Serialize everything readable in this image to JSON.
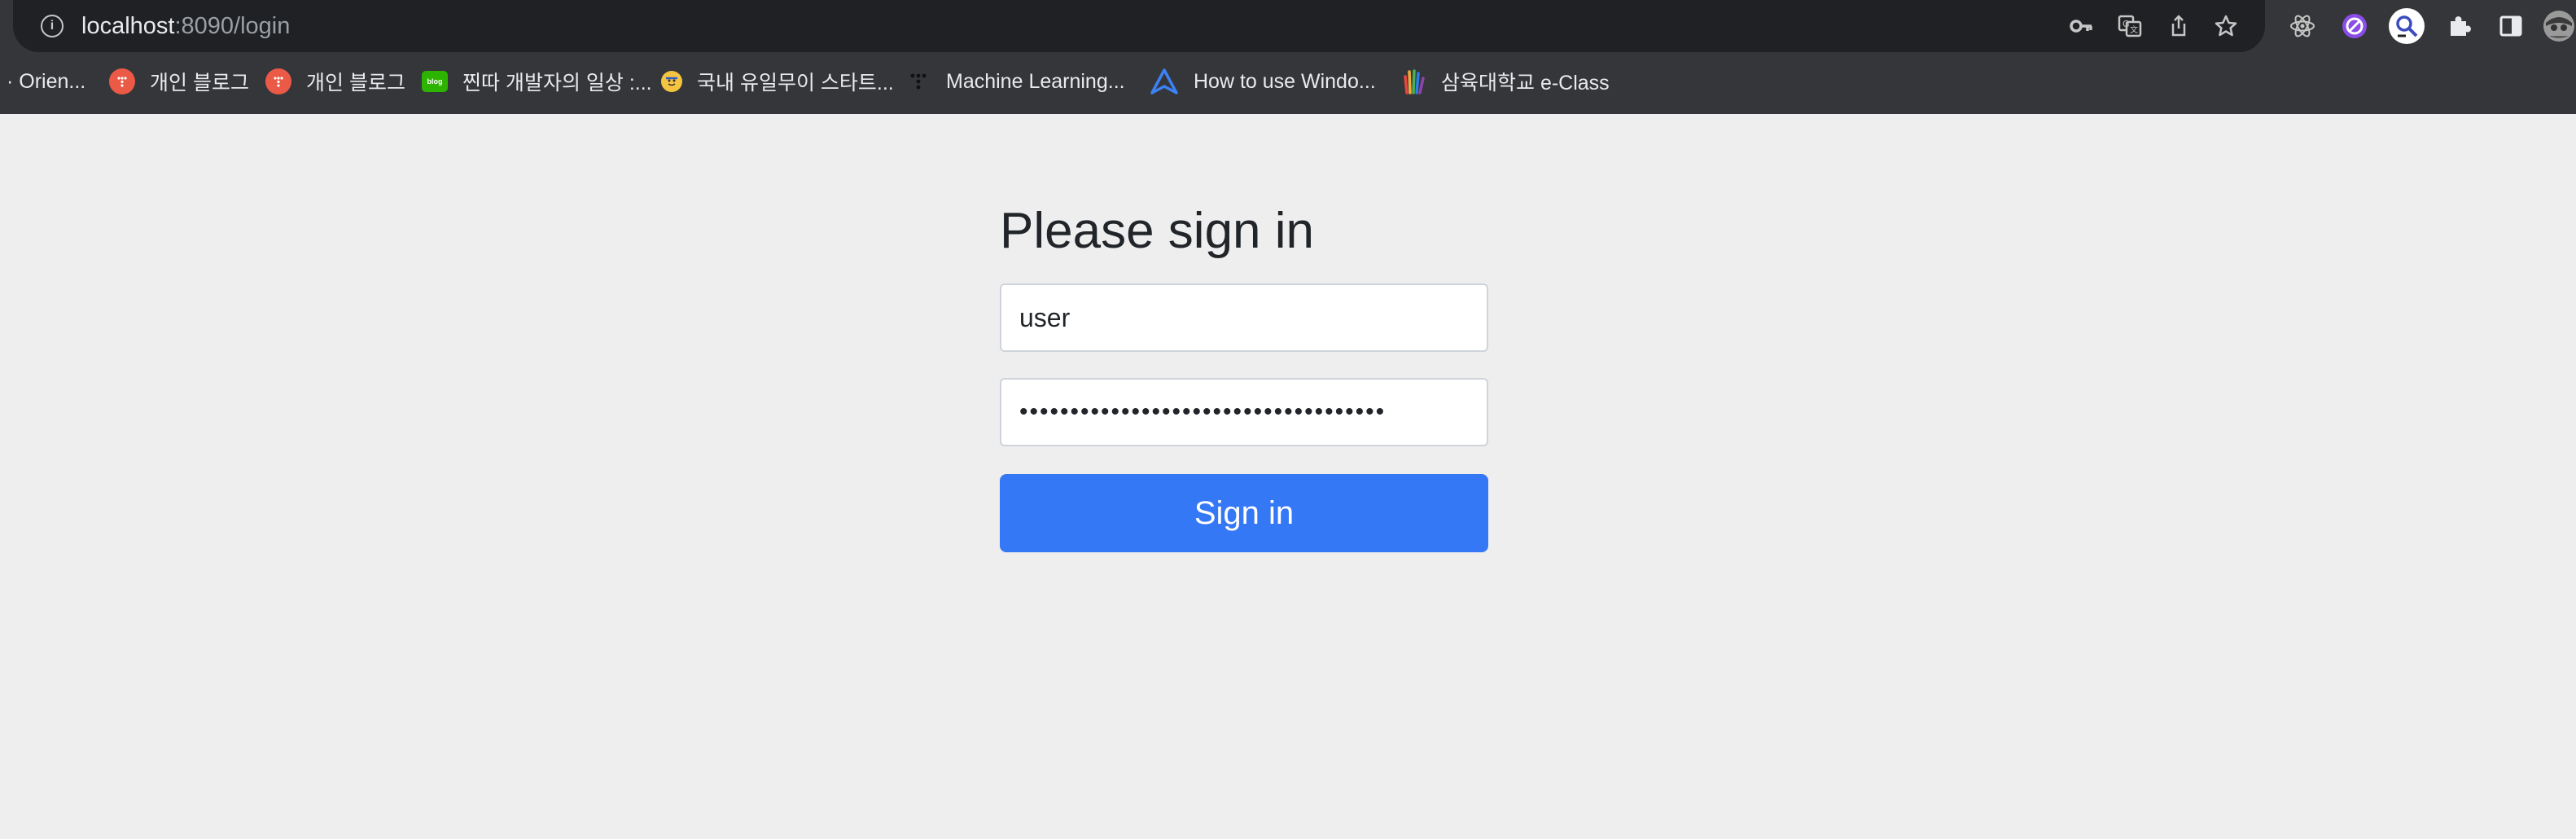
{
  "browser": {
    "url_host": "localhost",
    "url_path": ":8090/login",
    "toolbar_icons": [
      "info-icon",
      "key-icon",
      "translate-icon",
      "share-icon",
      "bookmark-star-icon",
      "react-devtools-icon",
      "ad-block-icon",
      "search-extension-icon",
      "extensions-puzzle-icon",
      "side-panel-icon",
      "profile-avatar-icon"
    ],
    "bookmarks": [
      {
        "label": "· Orien...",
        "icon": "none"
      },
      {
        "label": "개인 블로그",
        "icon": "blog-tistory-icon"
      },
      {
        "label": "개인 블로그",
        "icon": "blog-tistory-icon"
      },
      {
        "label": "찐따 개발자의 일상 :...",
        "icon": "naver-blog-icon"
      },
      {
        "label": "국내 유일무이 스타트...",
        "icon": "emoji-face-icon"
      },
      {
        "label": "Machine Learning...",
        "icon": "dots-grid-icon"
      },
      {
        "label": "How to use Windo...",
        "icon": "triangle-logo-icon"
      },
      {
        "label": "삼육대학교 e-Class",
        "icon": "hand-logo-icon"
      }
    ]
  },
  "login": {
    "title": "Please sign in",
    "username_value": "user",
    "password_value": "••••••••••••••••••••••••••••••••••••",
    "submit_label": "Sign in"
  },
  "colors": {
    "chrome_bg": "#35363a",
    "omnibox_bg": "#202124",
    "page_bg": "#eeeeee",
    "primary_button": "#3478f6",
    "tistory_red": "#eb5a46",
    "naver_green": "#2db400"
  }
}
